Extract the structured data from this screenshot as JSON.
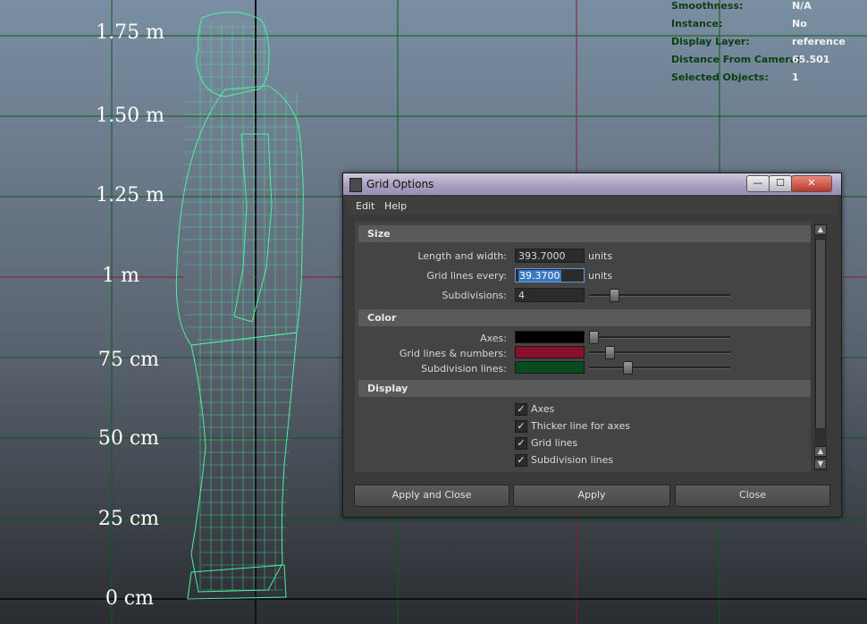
{
  "viewport": {
    "ruler_labels": [
      "1.75 m",
      "1.50 m",
      "1.25 m",
      "1 m",
      "75 cm",
      "50 cm",
      "25 cm",
      "0 cm"
    ],
    "grid_color": "#0a5c1a",
    "axis_color": "#8a1b2a",
    "wireframe_color": "#4df0a0"
  },
  "hud": {
    "rows": [
      {
        "key": "Smoothness:",
        "value": "N/A"
      },
      {
        "key": "Instance:",
        "value": "No"
      },
      {
        "key": "Display Layer:",
        "value": "reference"
      },
      {
        "key": "Distance From Camera:",
        "value": "65.501"
      },
      {
        "key": "Selected Objects:",
        "value": "1"
      }
    ]
  },
  "dialog": {
    "title": "Grid Options",
    "window_buttons": {
      "minimize": "—",
      "maximize": "☐",
      "close": "✕"
    },
    "menu": [
      "Edit",
      "Help"
    ],
    "size": {
      "header": "Size",
      "length_label": "Length and width:",
      "length_value": "393.7000",
      "grid_every_label": "Grid lines every:",
      "grid_every_value": "39.3700",
      "units": "units",
      "subdivisions_label": "Subdivisions:",
      "subdivisions_value": "4",
      "subdivisions_slider": 0.15
    },
    "color": {
      "header": "Color",
      "axes_label": "Axes:",
      "axes_color": "#000000",
      "axes_slider": 0.0,
      "gridlines_label": "Grid lines & numbers:",
      "gridlines_color": "#8a0f2a",
      "gridlines_slider": 0.12,
      "subdiv_label": "Subdivision lines:",
      "subdiv_color": "#0a4a1f",
      "subdiv_slider": 0.25
    },
    "display": {
      "header": "Display",
      "options": [
        {
          "label": "Axes",
          "checked": true
        },
        {
          "label": "Thicker line for axes",
          "checked": true
        },
        {
          "label": "Grid lines",
          "checked": true
        },
        {
          "label": "Subdivision lines",
          "checked": true
        }
      ]
    },
    "buttons": {
      "apply_close": "Apply and Close",
      "apply": "Apply",
      "close": "Close"
    }
  }
}
